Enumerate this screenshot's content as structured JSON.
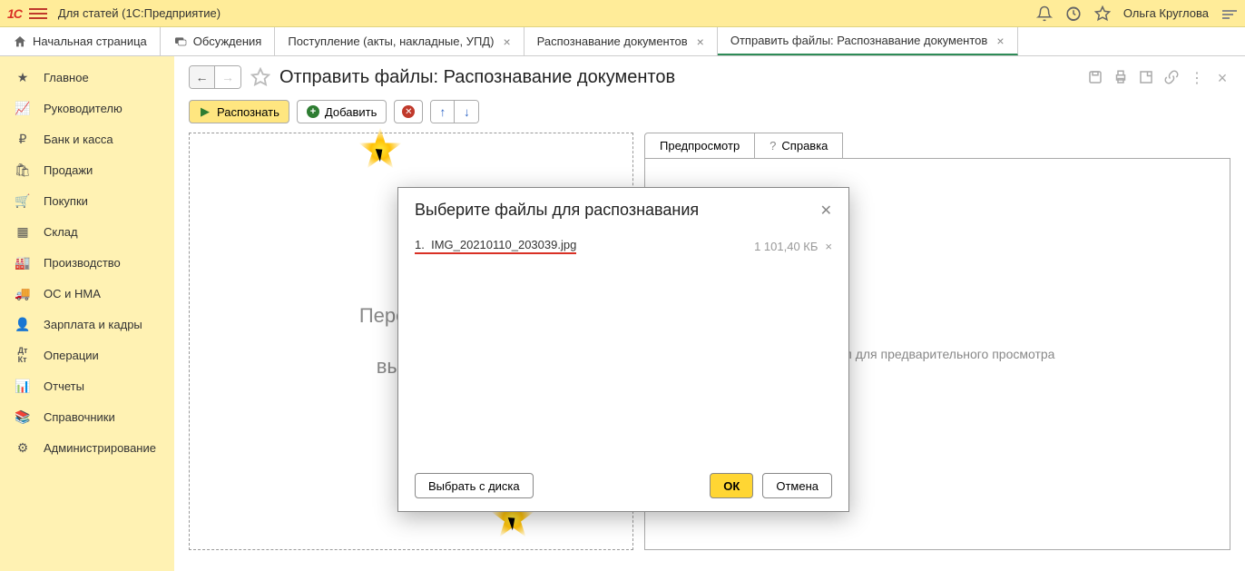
{
  "title_bar": {
    "app_title": "Для статей  (1С:Предприятие)",
    "user_name": "Ольга Круглова"
  },
  "tabs": {
    "home": "Начальная страница",
    "items": [
      {
        "label": "Обсуждения"
      },
      {
        "label": "Поступление (акты, накладные, УПД)"
      },
      {
        "label": "Распознавание документов"
      },
      {
        "label": "Отправить файлы: Распознавание документов",
        "active": true
      }
    ]
  },
  "sidebar": {
    "items": [
      {
        "label": "Главное",
        "icon": "star"
      },
      {
        "label": "Руководителю",
        "icon": "chart"
      },
      {
        "label": "Банк и касса",
        "icon": "ruble"
      },
      {
        "label": "Продажи",
        "icon": "bag"
      },
      {
        "label": "Покупки",
        "icon": "cart"
      },
      {
        "label": "Склад",
        "icon": "boxes"
      },
      {
        "label": "Производство",
        "icon": "factory"
      },
      {
        "label": "ОС и НМА",
        "icon": "truck"
      },
      {
        "label": "Зарплата и кадры",
        "icon": "person"
      },
      {
        "label": "Операции",
        "icon": "ops"
      },
      {
        "label": "Отчеты",
        "icon": "bars"
      },
      {
        "label": "Справочники",
        "icon": "book"
      },
      {
        "label": "Администрирование",
        "icon": "gear"
      }
    ]
  },
  "page": {
    "title": "Отправить файлы: Распознавание документов",
    "toolbar": {
      "recognize": "Распознать",
      "add": "Добавить"
    },
    "drop": {
      "line1": "Перетащит",
      "line2": "выбери"
    },
    "right_tabs": {
      "preview": "Предпросмотр",
      "help": "Справка"
    },
    "preview_hint": "файл для предварительного просмотра"
  },
  "dialog": {
    "title": "Выберите файлы для распознавания",
    "files": [
      {
        "index": "1.",
        "name": "IMG_20210110_203039.jpg",
        "size": "1 101,40 КБ"
      }
    ],
    "choose_disk": "Выбрать с диска",
    "ok": "ОК",
    "cancel": "Отмена"
  }
}
